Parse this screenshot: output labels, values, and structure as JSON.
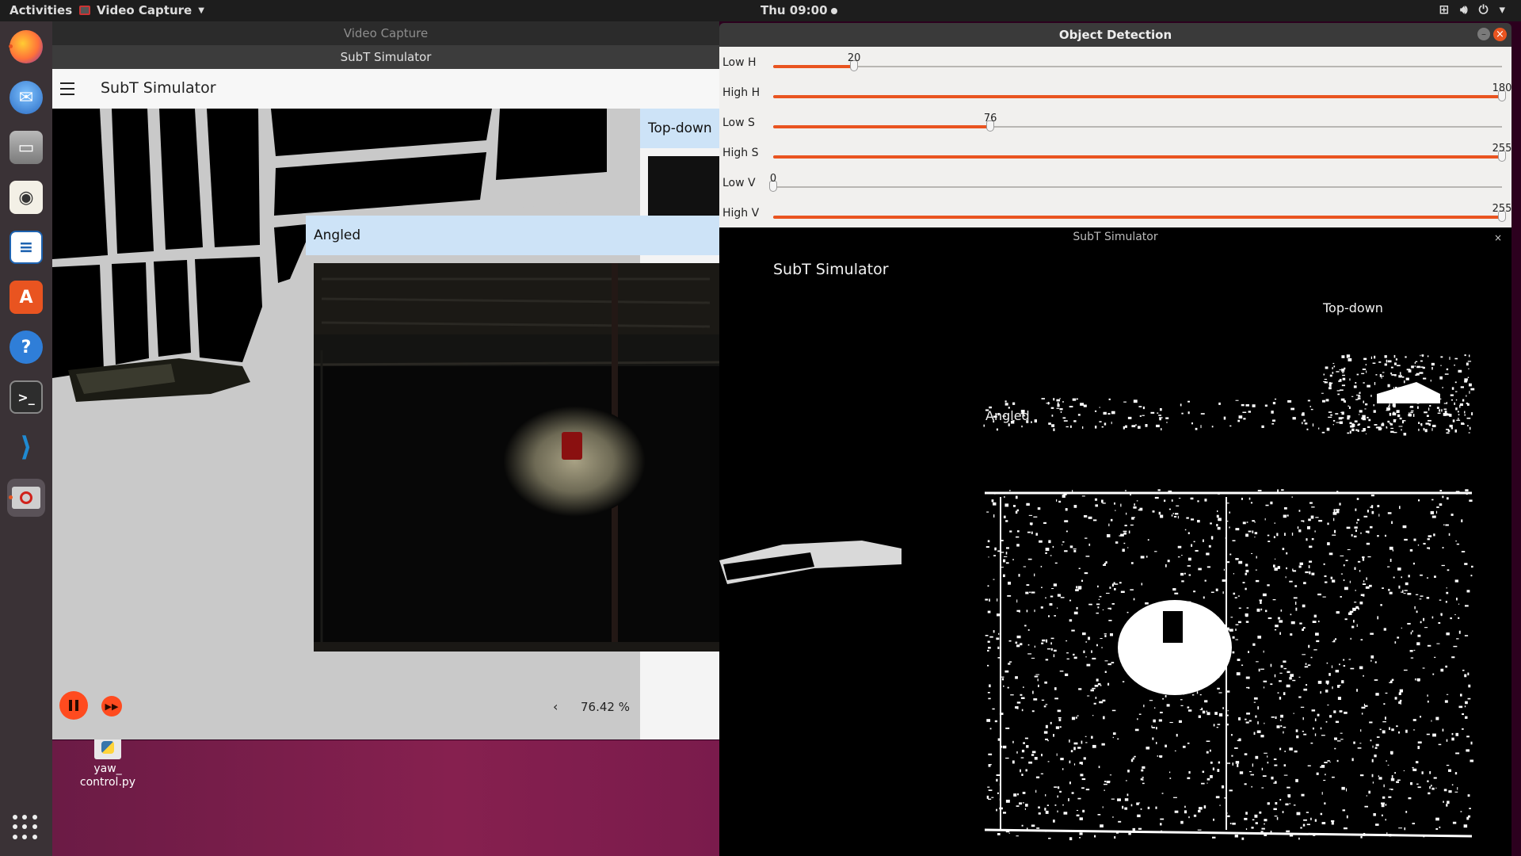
{
  "topbar": {
    "activities": "Activities",
    "app_menu": "Video Capture",
    "clock": "Thu 09:00"
  },
  "dock": {
    "items": [
      {
        "name": "firefox",
        "icon": "firefox-icon",
        "color": "#ff7139"
      },
      {
        "name": "thunderbird",
        "icon": "mail-icon",
        "color": "#2a6bc3"
      },
      {
        "name": "files",
        "icon": "files-icon",
        "color": "#8a8a8a"
      },
      {
        "name": "rhythmbox",
        "icon": "speaker-icon",
        "color": "#e8c84a"
      },
      {
        "name": "writer",
        "icon": "document-icon",
        "color": "#1e63b0"
      },
      {
        "name": "software",
        "icon": "store-icon",
        "color": "#e95420"
      },
      {
        "name": "help",
        "icon": "help-icon",
        "color": "#2f7ed8"
      },
      {
        "name": "terminal",
        "icon": "terminal-icon",
        "color": "#2d2d2d"
      },
      {
        "name": "vscode",
        "icon": "vscode-icon",
        "color": "#1f8ad2"
      },
      {
        "name": "video-capture",
        "icon": "video-capture-icon",
        "color": "#555555"
      }
    ]
  },
  "desktop": {
    "file_label": "yaw_\ncontrol.py"
  },
  "video_capture": {
    "window_title": "Video Capture",
    "inner_title": "SubT Simulator",
    "app_name": "SubT Simulator",
    "topdown_label": "Top-down",
    "angled_label": "Angled",
    "zoom": "76.42 %",
    "prev": "‹"
  },
  "object_detection": {
    "title": "Object Detection",
    "min_symbol": "–",
    "close_symbol": "×",
    "sliders": [
      {
        "label": "Low H",
        "value": "20",
        "fraction": 0.111
      },
      {
        "label": "High H",
        "value": "180",
        "fraction": 1.0
      },
      {
        "label": "Low S",
        "value": "76",
        "fraction": 0.298
      },
      {
        "label": "High S",
        "value": "255",
        "fraction": 1.0
      },
      {
        "label": "Low V",
        "value": "0",
        "fraction": 0.0
      },
      {
        "label": "High V",
        "value": "255",
        "fraction": 1.0
      }
    ],
    "mask_window_title": "SubT Simulator",
    "mask_close": "×",
    "mask_app_name": "SubT Simulator",
    "mask_topdown": "Top-down",
    "mask_angled": "Angled"
  }
}
